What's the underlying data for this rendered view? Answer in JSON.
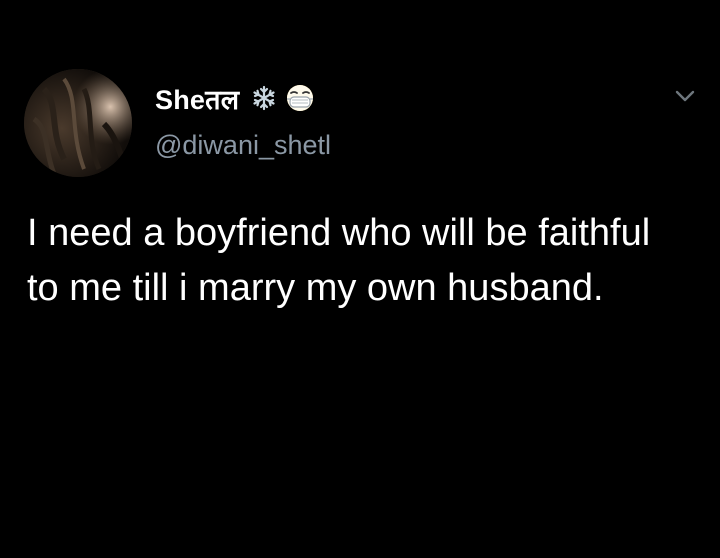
{
  "tweet": {
    "author": {
      "display_name": "Sheतल",
      "handle": "@diwani_shetl",
      "name_emojis": [
        "snowflake-icon",
        "face-with-medical-mask-icon"
      ]
    },
    "text": "I need a boyfriend who will be faithful to me till i marry my own husband."
  },
  "colors": {
    "background": "#000000",
    "name": "#ffffff",
    "handle": "#8b98a5",
    "text": "#ffffff",
    "snowflake": "#c9d6df",
    "mask_face": "#ffffff"
  }
}
